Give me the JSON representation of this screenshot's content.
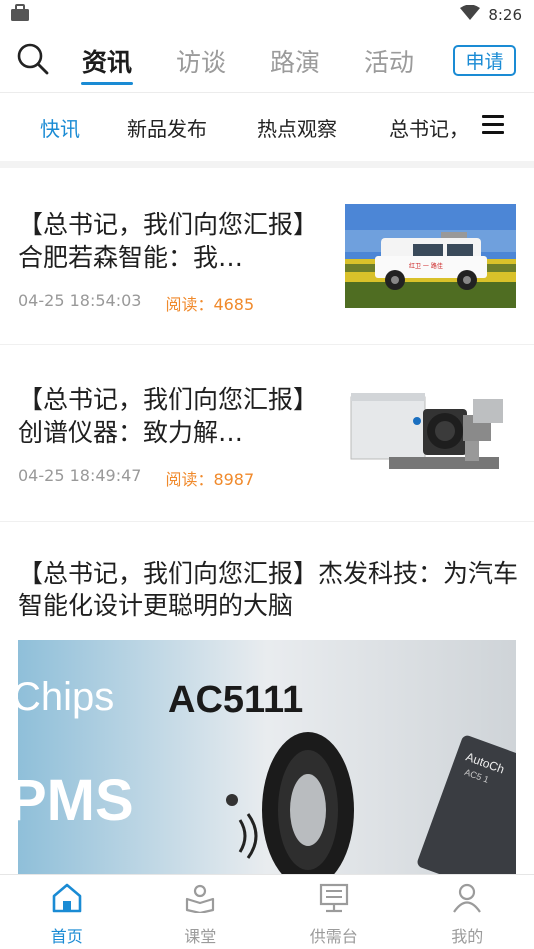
{
  "status_bar": {
    "time": "8:26",
    "left_icon": "briefcase-icon",
    "right_icon": "wifi-icon"
  },
  "header": {
    "search_icon": "search-icon",
    "tabs": [
      {
        "label": "资讯",
        "active": true
      },
      {
        "label": "访谈",
        "active": false
      },
      {
        "label": "路演",
        "active": false
      },
      {
        "label": "活动",
        "active": false
      }
    ],
    "apply_label": "申请"
  },
  "sub_tabs": {
    "items": [
      {
        "label": "快讯",
        "active": true
      },
      {
        "label": "新品发布",
        "active": false
      },
      {
        "label": "热点观察",
        "active": false
      },
      {
        "label": "总书记，",
        "active": false
      }
    ],
    "menu_icon": "menu-icon"
  },
  "articles": [
    {
      "title": "【总书记，我们向您汇报】合肥若森智能：我…",
      "time": "04-25 18:54:03",
      "reads": "阅读：4685",
      "thumb_text": "红卫 一 路佳"
    },
    {
      "title": "【总书记，我们向您汇报】创谱仪器：致力解…",
      "time": "04-25 18:49:47",
      "reads": "阅读：8987"
    }
  ],
  "feature": {
    "title": "【总书记，我们向您汇报】杰发科技：为汽车智能化设计更聪明的大脑",
    "image_text": {
      "chips": "Chips",
      "model": "AC5111",
      "pms": "PMS",
      "chip_label": "AutoCh",
      "chip_sub": "AC5 1"
    }
  },
  "bottom_nav": [
    {
      "label": "首页",
      "icon": "home-icon",
      "active": true
    },
    {
      "label": "课堂",
      "icon": "classroom-icon",
      "active": false
    },
    {
      "label": "供需台",
      "icon": "supply-demand-icon",
      "active": false
    },
    {
      "label": "我的",
      "icon": "profile-icon",
      "active": false
    }
  ],
  "colors": {
    "accent": "#1a8bd4",
    "reads": "#f08a2c",
    "muted": "#9b9b9b"
  }
}
